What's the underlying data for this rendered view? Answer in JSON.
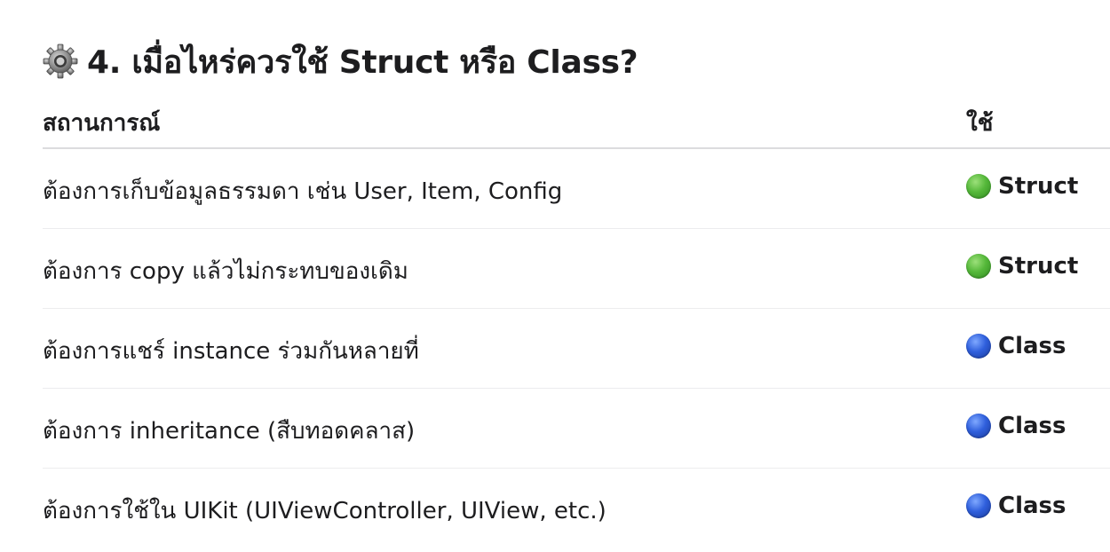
{
  "heading": {
    "icon": "gear-icon",
    "title": "4. เมื่อไหร่ควรใช้ Struct หรือ Class?"
  },
  "table": {
    "headers": {
      "situation": "สถานการณ์",
      "use": "ใช้"
    },
    "rows": [
      {
        "situation": "ต้องการเก็บข้อมูลธรรมดา เช่น User, Item, Config",
        "use": "Struct",
        "indicator": "green-circle-icon",
        "color": "#4caf37"
      },
      {
        "situation": "ต้องการ copy แล้วไม่กระทบของเดิม",
        "use": "Struct",
        "indicator": "green-circle-icon",
        "color": "#4caf37"
      },
      {
        "situation": "ต้องการแชร์ instance ร่วมกันหลายที่",
        "use": "Class",
        "indicator": "blue-circle-icon",
        "color": "#2a57d6"
      },
      {
        "situation": "ต้องการ inheritance (สืบทอดคลาส)",
        "use": "Class",
        "indicator": "blue-circle-icon",
        "color": "#2a57d6"
      },
      {
        "situation": "ต้องการใช้ใน UIKit (UIViewController, UIView, etc.)",
        "use": "Class",
        "indicator": "blue-circle-icon",
        "color": "#2a57d6"
      }
    ]
  }
}
